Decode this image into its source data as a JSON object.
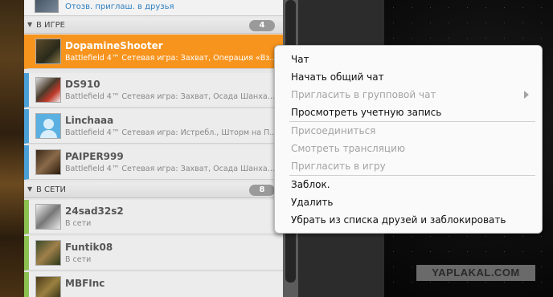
{
  "top_partial": {
    "status": "Отозв. приглаш. в друзья"
  },
  "groups": {
    "ingame": {
      "label": "В ИГРЕ",
      "count": "4"
    },
    "online": {
      "label": "В СЕТИ",
      "count": "8"
    }
  },
  "friends_ingame": [
    {
      "name": "DopamineShooter",
      "status": "Battlefield 4™ Сетевая игра: Захват, Операция «Вз..."
    },
    {
      "name": "DS910",
      "status": "Battlefield 4™ Сетевая игра: Захват, Осада Шанхая..."
    },
    {
      "name": "Linchaaa",
      "status": "Battlefield 4™ Сетевая игра: Истребл., Шторм на П..."
    },
    {
      "name": "PAIPER999",
      "status": "Battlefield 4™ Сетевая игра: Захват, Осада Шанхая..."
    }
  ],
  "friends_online": [
    {
      "name": "24sad32s2",
      "status": "В сети"
    },
    {
      "name": "Funtik08",
      "status": "В сети"
    },
    {
      "name": "MBFInc",
      "status": ""
    }
  ],
  "context_menu": {
    "chat": "Чат",
    "group_chat": "Начать общий чат",
    "invite_group_chat": "Пригласить в групповой чат",
    "view_account": "Просмотреть учетную запись",
    "join": "Присоединиться",
    "watch_stream": "Смотреть трансляцию",
    "invite_game": "Пригласить в игру",
    "block": "Заблок.",
    "remove": "Удалить",
    "remove_block": "Убрать из списка друзей и заблокировать"
  },
  "watermark": "YAPLAKAL.COM",
  "colors": {
    "selected": "#f7941d",
    "ingame": "#4a9fd6",
    "online": "#8cc152"
  }
}
